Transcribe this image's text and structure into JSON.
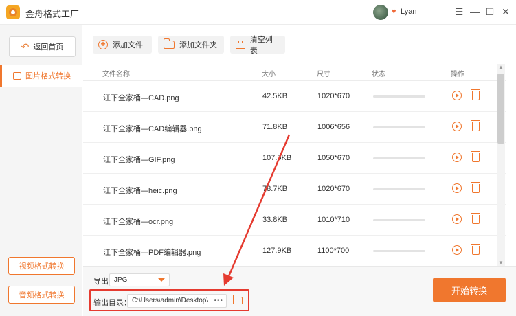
{
  "app": {
    "title": "金舟格式工厂",
    "username": "Lyan"
  },
  "window_controls": {
    "menu": "☰",
    "minimize": "—",
    "maximize": "☐",
    "close": "✕"
  },
  "sidebar": {
    "back_label": "返回首页",
    "active_item": "图片格式转换",
    "video_label": "视频格式转换",
    "audio_label": "音频格式转换"
  },
  "toolbar": {
    "add_file": "添加文件",
    "add_folder": "添加文件夹",
    "clear_list": "清空列表"
  },
  "table": {
    "headers": [
      "文件名称",
      "大小",
      "尺寸",
      "状态",
      "操作"
    ],
    "rows": [
      {
        "name": "江下全家桶—CAD.png",
        "size": "42.5KB",
        "dims": "1020*670"
      },
      {
        "name": "江下全家桶—CAD编辑器.png",
        "size": "71.8KB",
        "dims": "1006*656"
      },
      {
        "name": "江下全家桶—GIF.png",
        "size": "107.5KB",
        "dims": "1050*670"
      },
      {
        "name": "江下全家桶—heic.png",
        "size": "78.7KB",
        "dims": "1020*670"
      },
      {
        "name": "江下全家桶—ocr.png",
        "size": "33.8KB",
        "dims": "1010*710"
      },
      {
        "name": "江下全家桶—PDF编辑器.png",
        "size": "127.9KB",
        "dims": "1100*700"
      }
    ]
  },
  "bottom": {
    "format_label": "导出格式：",
    "format_value": "JPG",
    "output_label": "输出目录：",
    "output_path": "C:\\Users\\admin\\Desktop\\",
    "more": "•••",
    "start_button": "开始转换"
  },
  "colors": {
    "accent": "#f0772e",
    "annotation": "#e53b30"
  }
}
